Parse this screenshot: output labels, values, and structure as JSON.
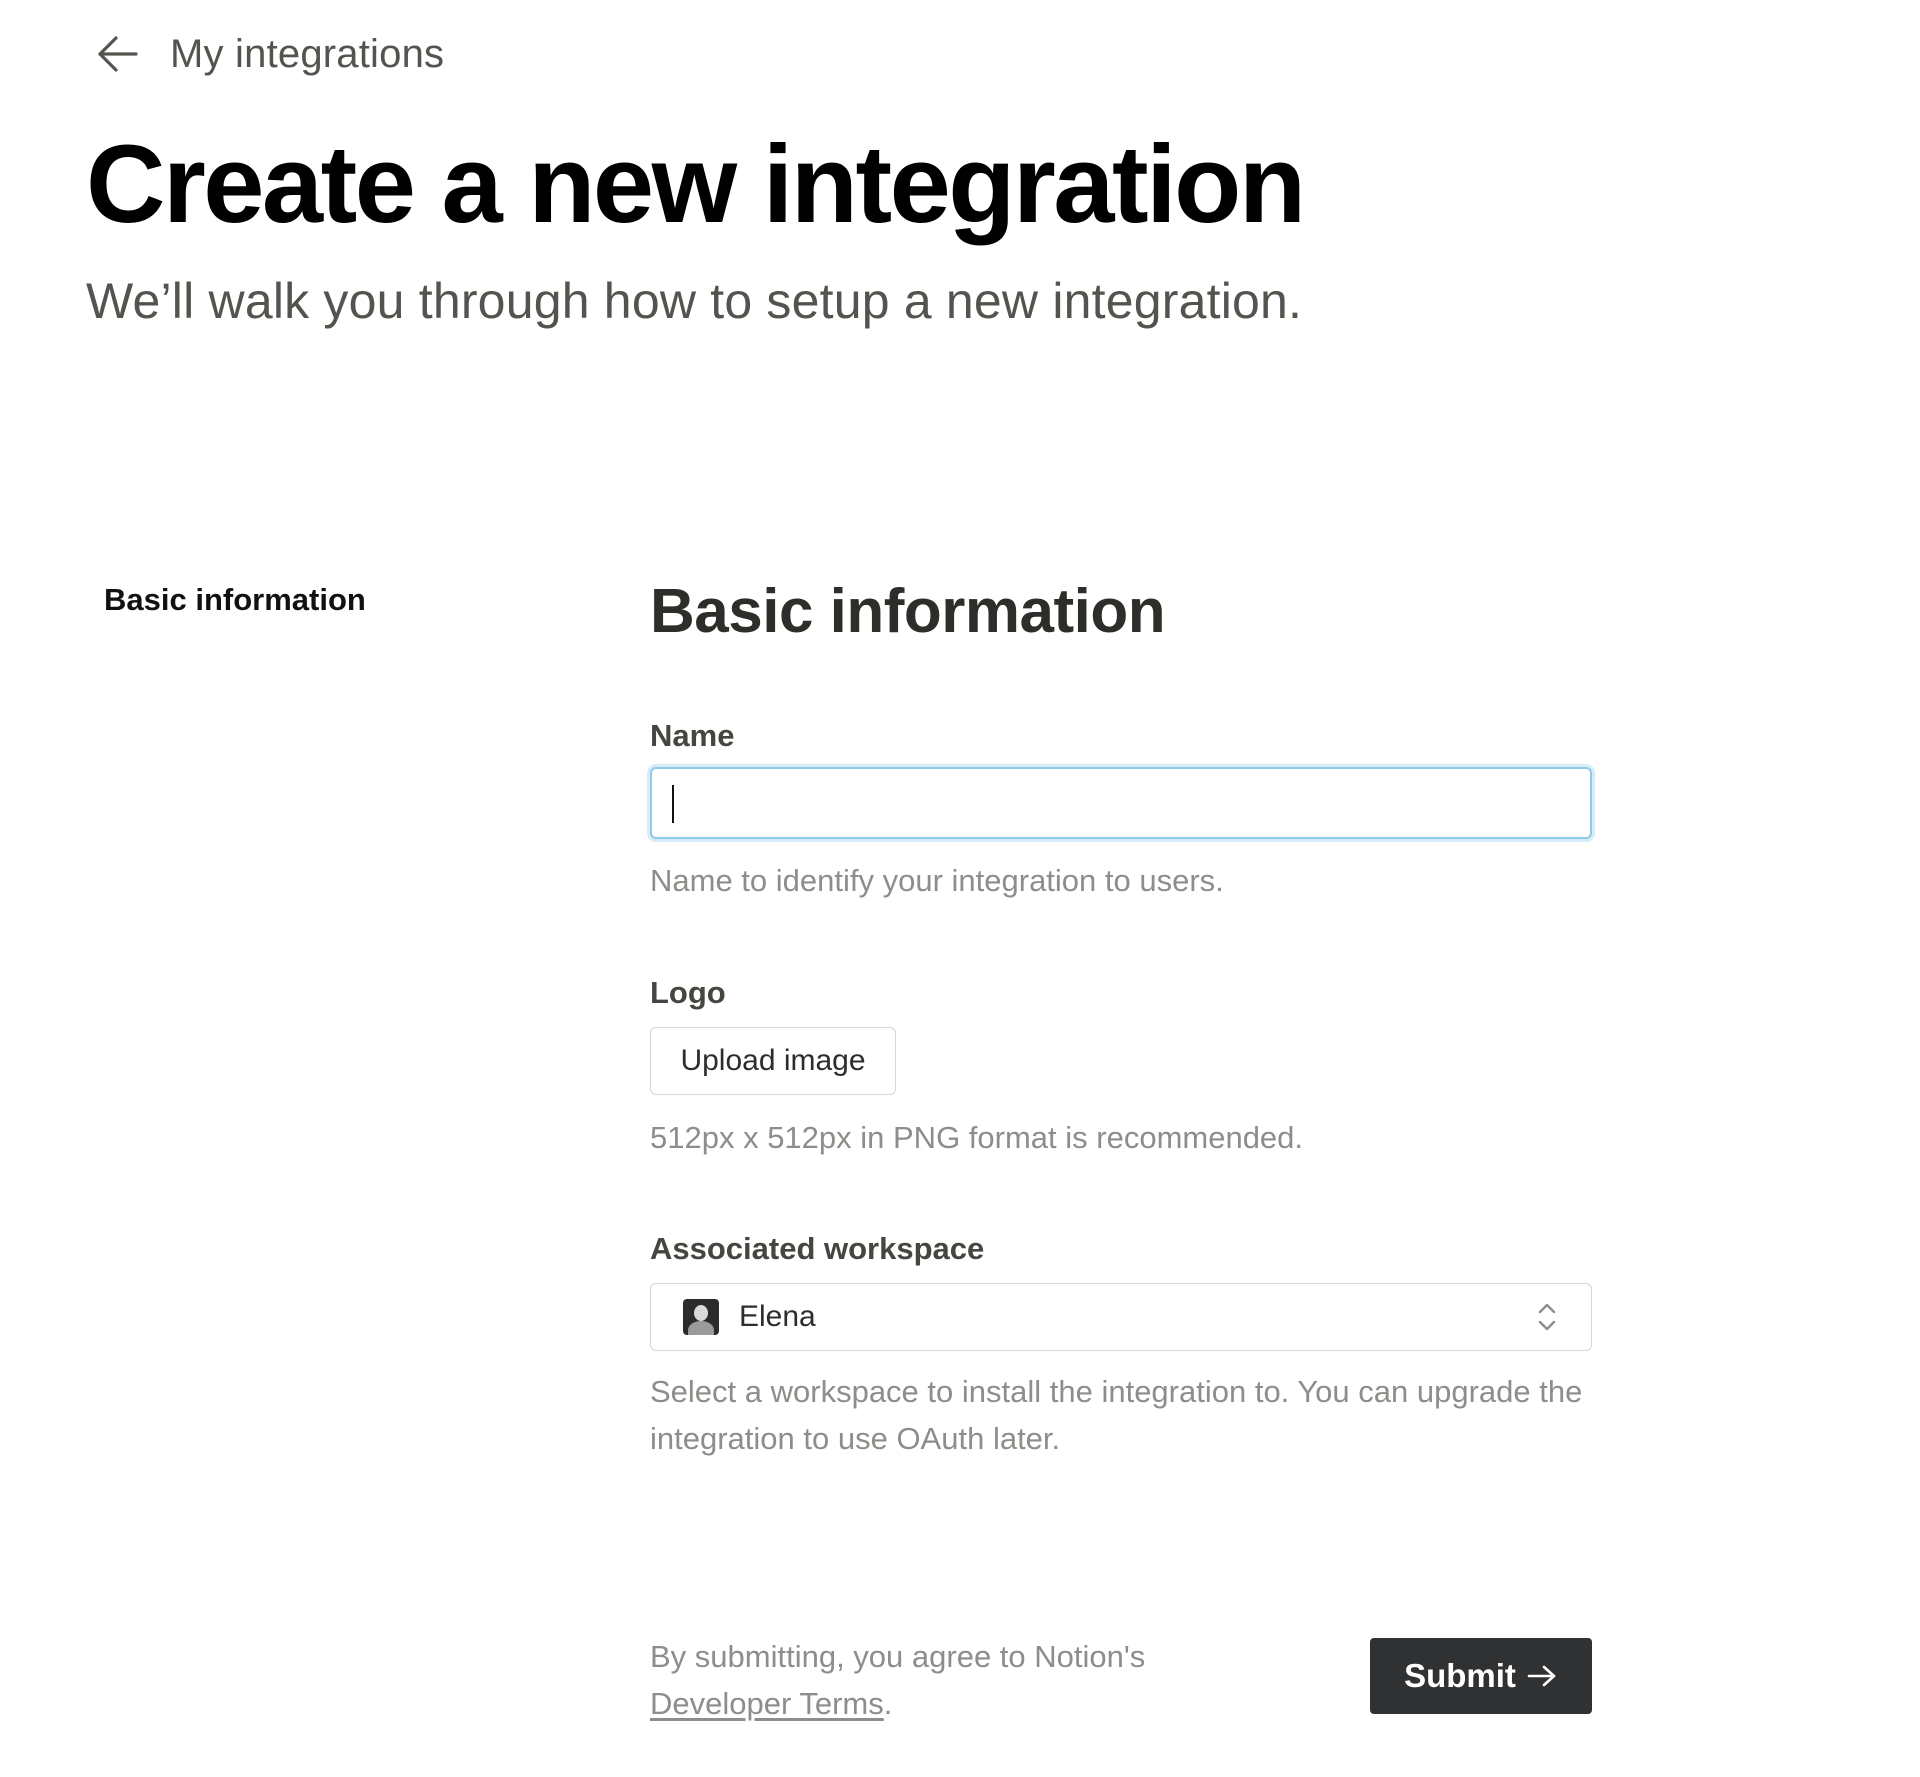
{
  "back_link": {
    "icon": "arrow-left-icon",
    "label": "My integrations"
  },
  "header": {
    "title": "Create a new integration",
    "subtitle": "We’ll walk you through how to setup a new integration."
  },
  "side_nav": {
    "items": [
      {
        "label": "Basic information"
      }
    ]
  },
  "form": {
    "section_title": "Basic information",
    "name": {
      "label": "Name",
      "value": "",
      "placeholder": "",
      "hint": "Name to identify your integration to users."
    },
    "logo": {
      "label": "Logo",
      "button_label": "Upload image",
      "hint": "512px x 512px in PNG format is recommended."
    },
    "workspace": {
      "label": "Associated workspace",
      "selected": "Elena",
      "avatar_icon": "user-avatar-icon",
      "chevron_icon": "chevron-up-down-icon",
      "hint": "Select a workspace to install the integration to. You can upgrade the integration to use OAuth later."
    }
  },
  "footer": {
    "terms_prefix": "By submitting, you agree to Notion's",
    "terms_link": "Developer Terms",
    "terms_suffix": ".",
    "submit_label": "Submit",
    "submit_icon": "arrow-right-icon"
  },
  "colors": {
    "input_focus_border": "#8fcbe7",
    "submit_background": "#2f3133",
    "hint_text": "#8f8d89"
  }
}
